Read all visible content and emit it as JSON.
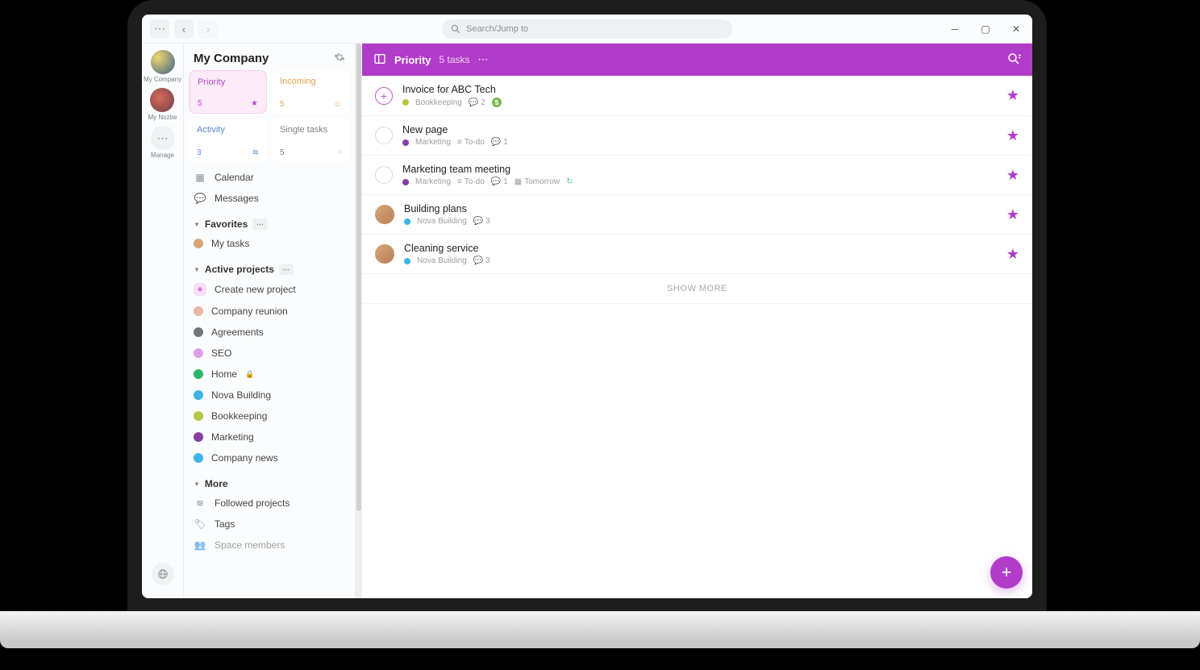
{
  "titlebar": {
    "searchPlaceholder": "Search/Jump to"
  },
  "rail": {
    "items": [
      {
        "label": "My Company"
      },
      {
        "label": "My Nozbe"
      },
      {
        "label": "Manage"
      }
    ]
  },
  "sidebar": {
    "title": "My Company",
    "cards": {
      "priority": {
        "title": "Priority",
        "count": "5"
      },
      "incoming": {
        "title": "Incoming",
        "count": "5"
      },
      "activity": {
        "title": "Activity",
        "count": "3"
      },
      "single": {
        "title": "Single tasks",
        "count": "5"
      }
    },
    "calendar": "Calendar",
    "messages": "Messages",
    "favoritesHead": "Favorites",
    "favorites": [
      {
        "label": "My tasks"
      }
    ],
    "projectsHead": "Active projects",
    "createProject": "Create new project",
    "projects": [
      {
        "label": "Company reunion",
        "color": "#e9b6a8"
      },
      {
        "label": "Agreements",
        "color": "#6f7579"
      },
      {
        "label": "SEO",
        "color": "#dd9de6"
      },
      {
        "label": "Home",
        "color": "#29b765",
        "locked": true
      },
      {
        "label": "Nova Building",
        "color": "#3db4e7"
      },
      {
        "label": "Bookkeeping",
        "color": "#b7c63f"
      },
      {
        "label": "Marketing",
        "color": "#8a3fa3"
      },
      {
        "label": "Company news",
        "color": "#3db4e7"
      }
    ],
    "moreHead": "More",
    "moreItems": [
      {
        "label": "Followed projects"
      },
      {
        "label": "Tags"
      },
      {
        "label": "Space members"
      }
    ]
  },
  "main": {
    "header": {
      "title": "Priority",
      "count": "5 tasks"
    },
    "tasks": [
      {
        "title": "Invoice for ABC Tech",
        "project": "Bookkeeping",
        "projectColor": "#b7c63f",
        "comments": "2",
        "money": true
      },
      {
        "title": "New page",
        "project": "Marketing",
        "projectColor": "#8a3fa3",
        "section": "To-do",
        "comments": "1"
      },
      {
        "title": "Marketing team meeting",
        "project": "Marketing",
        "projectColor": "#8a3fa3",
        "section": "To-do",
        "comments": "1",
        "date": "Tomorrow",
        "repeat": true
      },
      {
        "title": "Building plans",
        "project": "Nova Building",
        "projectColor": "#3db4e7",
        "comments": "3",
        "avatar": true
      },
      {
        "title": "Cleaning service",
        "project": "Nova Building",
        "projectColor": "#3db4e7",
        "comments": "3",
        "avatar": true
      }
    ],
    "showMore": "SHOW MORE"
  }
}
